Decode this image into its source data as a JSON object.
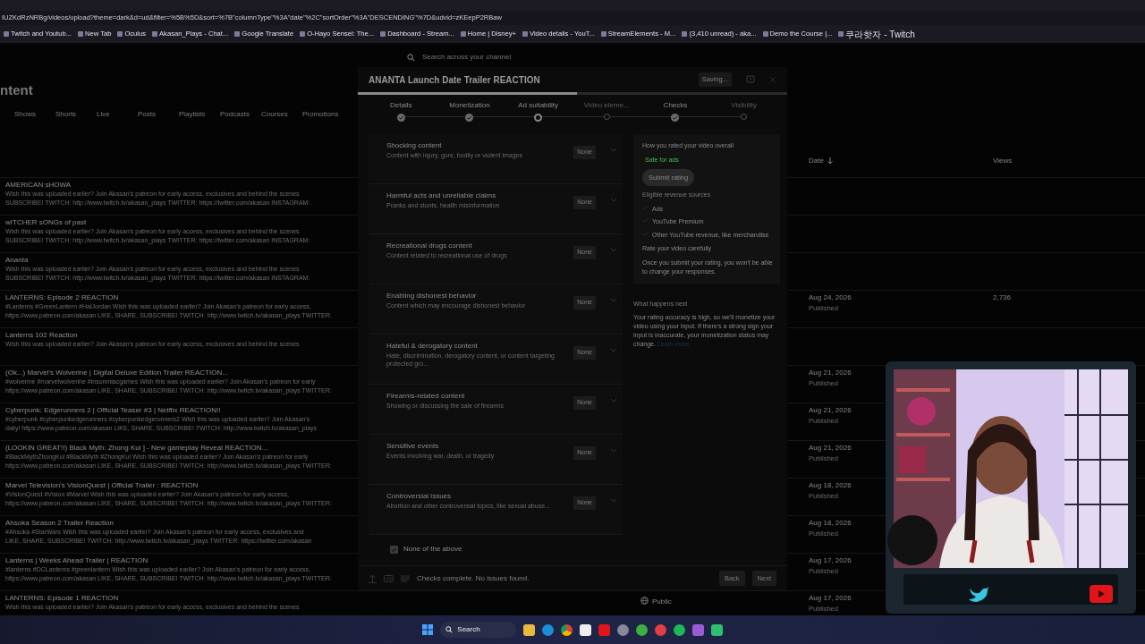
{
  "browser": {
    "url": "IUZKdRzNRBg/videos/upload?theme=dark&d=ud&filter=%5B%5D&sort=%7B\"columnType\"%3A\"date\"%2C\"sortOrder\"%3A\"DESCENDING\"%7D&udvid=zKEepP2RBaw",
    "bookmarks": [
      "Twitch and Youtub...",
      "New Tab",
      "Oculus",
      "Akasan_Plays - Chat...",
      "Google Translate",
      "O-Hayo Sensei: The...",
      "Dashboard - Stream...",
      "Home | Disney+",
      "Video details - YouT...",
      "StreamElements - M...",
      "(3,410 unread) - aka...",
      "Demo the Course |...",
      "쿠라핫자 - Twitch"
    ]
  },
  "studio": {
    "search_placeholder": "Search across your channel",
    "heading": "ntent",
    "tabs": [
      "Shows",
      "Shorts",
      "Live",
      "Posts",
      "Playlists",
      "Podcasts",
      "Courses",
      "Promotions"
    ],
    "columns": {
      "date": "Date",
      "views": "Views"
    },
    "rows": [
      {
        "title": "AMERICAN sHOWA",
        "desc": [
          "Wish this was uploaded earlier? Join Akasan's patreon for early access, exclusives and behind the scenes",
          "SUBSCRIBE! TWITCH: http://www.twitch.tv/akasan_plays TWITTER: https://twitter.com/akasan INSTAGRAM:"
        ]
      },
      {
        "title": "wITCHER sONGs of past",
        "desc": [
          "Wish this was uploaded earlier? Join Akasan's patreon for early access, exclusives and behind the scenes",
          "SUBSCRIBE! TWITCH: http://www.twitch.tv/akasan_plays TWITTER: https://twitter.com/akasan INSTAGRAM:"
        ]
      },
      {
        "title": "Ananta",
        "desc": [
          "Wish this was uploaded earlier? Join Akasan's patreon for early access, exclusives and behind the scenes",
          "SUBSCRIBE! TWITCH: http://www.twitch.tv/akasan_plays TWITTER: https://twitter.com/akasan INSTAGRAM:"
        ]
      },
      {
        "title": "LANTERNS: Episode 2 REACTION",
        "desc": [
          "#Lanterns #GreenLantern #HalJordan Wish this was uploaded earlier? Join Akasan's patreon for early access,",
          "https://www.patreon.com/akasan LIKE, SHARE, SUBSCRIBE! TWITCH: http://www.twitch.tv/akasan_plays TWITTER:"
        ],
        "date": "Aug 24, 2026",
        "status": "Published",
        "views": "2,736"
      },
      {
        "title": "Lanterns 102 Reaction",
        "desc": [
          "Wish this was uploaded earlier? Join Akasan's patreon for early access, exclusives and behind the scenes"
        ]
      },
      {
        "title": "(Ok...) Marvel's Wolverine | Digital Deluxe Edition Trailer REACTION...",
        "desc": [
          "#wolverine #marvelwolverine #insomniacgames Wish this was uploaded earlier? Join Akasan's patreon for early",
          "https://www.patreon.com/akasan LIKE, SHARE, SUBSCRIBE! TWITCH: http://www.twitch.tv/akasan_plays TWITTER:"
        ],
        "date": "Aug 21, 2026",
        "status": "Published"
      },
      {
        "title": "Cyberpunk: Edgerunners 2 | Official Teaser #3 | Netflix REACTION!!",
        "desc": [
          "#cyberpunk #cyberpunkedgerunners #cyberpunkedgerunners2 Wish this was uploaded earlier? Join Akasan's",
          "daily! https://www.patreon.com/akasan LIKE, SHARE, SUBSCRIBE! TWITCH: http://www.twitch.tv/akasan_plays"
        ],
        "date": "Aug 21, 2026",
        "status": "Published"
      },
      {
        "title": "(LOOKIN GREAT!!) Black Myth: Zhong Kui  ] - New gameplay Reveal REACTION...",
        "desc": [
          "#BlackMythZhongKui #BlackMyth #ZhongKui Wish this was uploaded earlier? Join Akasan's patreon for early",
          "https://www.patreon.com/akasan LIKE, SHARE, SUBSCRIBE! TWITCH: http://www.twitch.tv/akasan_plays TWITTER:"
        ],
        "date": "Aug 21, 2026",
        "status": "Published"
      },
      {
        "title": "Marvel Television's VisionQuest | Official Trailer : REACTION",
        "desc": [
          "#VisionQuest #Vision #Marvel Wish this was uploaded earlier? Join Akasan's patreon for early access,",
          "https://www.patreon.com/akasan LIKE, SHARE, SUBSCRIBE! TWITCH: http://www.twitch.tv/akasan_plays TWITTER:"
        ],
        "date": "Aug 18, 2026",
        "status": "Published"
      },
      {
        "title": "Ahsoka Season 2 Trailer Reaction",
        "desc": [
          "#Ahsoka #StarWars Wish this was uploaded earlier? Join Akasan's patreon for early access, exclusives and",
          "LIKE, SHARE, SUBSCRIBE! TWITCH: http://www.twitch.tv/akasan_plays TWITTER: https://twitter.com/akasan"
        ],
        "date": "Aug 18, 2026",
        "status": "Published"
      },
      {
        "title": "Lanterns | Weeks Ahead Trailer | REACTION",
        "desc": [
          "#lanterns #DCLanterns #greenlantern Wish this was uploaded earlier? Join Akasan's patreon for early access,",
          "https://www.patreon.com/akasan LIKE, SHARE, SUBSCRIBE! TWITCH: http://www.twitch.tv/akasan_plays TWITTER:"
        ],
        "date": "Aug 17, 2026",
        "status": "Published"
      },
      {
        "title": "LANTERNS: Episode 1 REACTION",
        "desc": [
          "Wish this was uploaded earlier? Join Akasan's patreon for early access, exclusives and behind the scenes"
        ],
        "visibility": "Public",
        "date": "Aug 17, 2026",
        "status": "Published"
      }
    ]
  },
  "dialog": {
    "title": "ANANTA Launch Date Trailer REACTION",
    "saving": "Saving...",
    "upload_progress": {
      "level": 0.51
    },
    "steps": [
      {
        "label": "Details",
        "kind": "done"
      },
      {
        "label": "Monetization",
        "kind": "done"
      },
      {
        "label": "Ad suitability",
        "kind": "current"
      },
      {
        "label": "Video eleme...",
        "kind": "pending"
      },
      {
        "label": "Checks",
        "kind": "done"
      },
      {
        "label": "Visibility",
        "kind": "pending"
      }
    ],
    "categories": [
      {
        "title": "Shocking content",
        "subtitle": "Content with injury, gore, bodily or violent images",
        "answer": "None"
      },
      {
        "title": "Harmful acts and unreliable claims",
        "subtitle": "Pranks and stunts, health misinformation",
        "answer": "None"
      },
      {
        "title": "Recreational drugs content",
        "subtitle": "Content related to recreational use of drugs",
        "answer": "None"
      },
      {
        "title": "Enabling dishonest behavior",
        "subtitle": "Content which may encourage dishonest behavior",
        "answer": "None"
      },
      {
        "title": "Hateful & derogatory content",
        "subtitle": "Hate, discrimination, derogatory content, or content targeting protected gro...",
        "answer": "None"
      },
      {
        "title": "Firearms-related content",
        "subtitle": "Showing or discussing the sale of firearms",
        "answer": "None"
      },
      {
        "title": "Sensitive events",
        "subtitle": "Events involving war, death, or tragedy",
        "answer": "None"
      },
      {
        "title": "Controversial issues",
        "subtitle": "Abortion and other controversial topics, like sexual abuse...",
        "answer": "None"
      }
    ],
    "none_of_above": {
      "label": "None of the above",
      "checked": true
    },
    "summary": {
      "heading": "How you rated your video overall",
      "rating": "Safe for ads",
      "submit": "Submit rating",
      "submit_disabled": true,
      "revenue_heading": "Eligible revenue sources",
      "revenue": [
        "Ads",
        "YouTube Premium",
        "Other YouTube revenue, like merchandise"
      ],
      "note_heading": "Rate your video carefully",
      "note": "Once you submit your rating, you won't be able to change your responses."
    },
    "next": {
      "heading": "What happens next",
      "text": "Your rating accuracy is high, so we'll monetize your video using your input. If there's a strong sign your input is inaccurate, your monetization status may change.",
      "link": "Learn more"
    },
    "footer": {
      "status": "Checks complete. No issues found.",
      "back": "Back",
      "next": "Next"
    }
  },
  "taskbar": {
    "search": "Search"
  }
}
